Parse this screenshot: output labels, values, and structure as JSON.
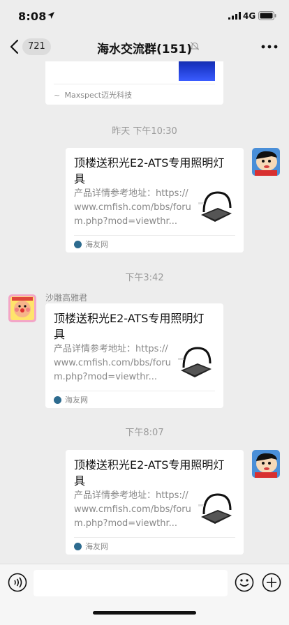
{
  "status_bar": {
    "time": "8:08",
    "network": "4G"
  },
  "nav": {
    "unread_count": "721",
    "title": "海水交流群(151)"
  },
  "chat": {
    "previous_card": {
      "source": "Maxspect迈光科技"
    },
    "messages": [
      {
        "timestamp": "昨天 下午10:30",
        "side": "right",
        "sender": "",
        "card": {
          "title": "顶楼送积光E2-ATS专用照明灯具",
          "description": "产品详情参考地址：https://www.cmfish.com/bbs/forum.php?mod=viewthr...",
          "source": "海友网"
        }
      },
      {
        "timestamp": "下午3:42",
        "side": "left",
        "sender": "沙雕高雅君",
        "card": {
          "title": "顶楼送积光E2-ATS专用照明灯具",
          "description": "产品详情参考地址：https://www.cmfish.com/bbs/forum.php?mod=viewthr...",
          "source": "海友网"
        }
      },
      {
        "timestamp": "下午8:07",
        "side": "right",
        "sender": "",
        "card": {
          "title": "顶楼送积光E2-ATS专用照明灯具",
          "description": "产品详情参考地址：https://www.cmfish.com/bbs/forum.php?mod=viewthr...",
          "source": "海友网"
        }
      }
    ]
  },
  "icons": {
    "location": "location-arrow-icon",
    "signal": "signal-bars-icon",
    "battery": "battery-icon",
    "back": "chevron-left-icon",
    "mute": "bell-muted-icon",
    "more": "more-dots-icon",
    "voice": "voice-icon",
    "emoji": "emoji-icon",
    "plus": "plus-icon"
  },
  "colors": {
    "background": "#ededed",
    "card": "#ffffff",
    "muted_text": "#888888",
    "timestamp": "#9a9a9a"
  }
}
